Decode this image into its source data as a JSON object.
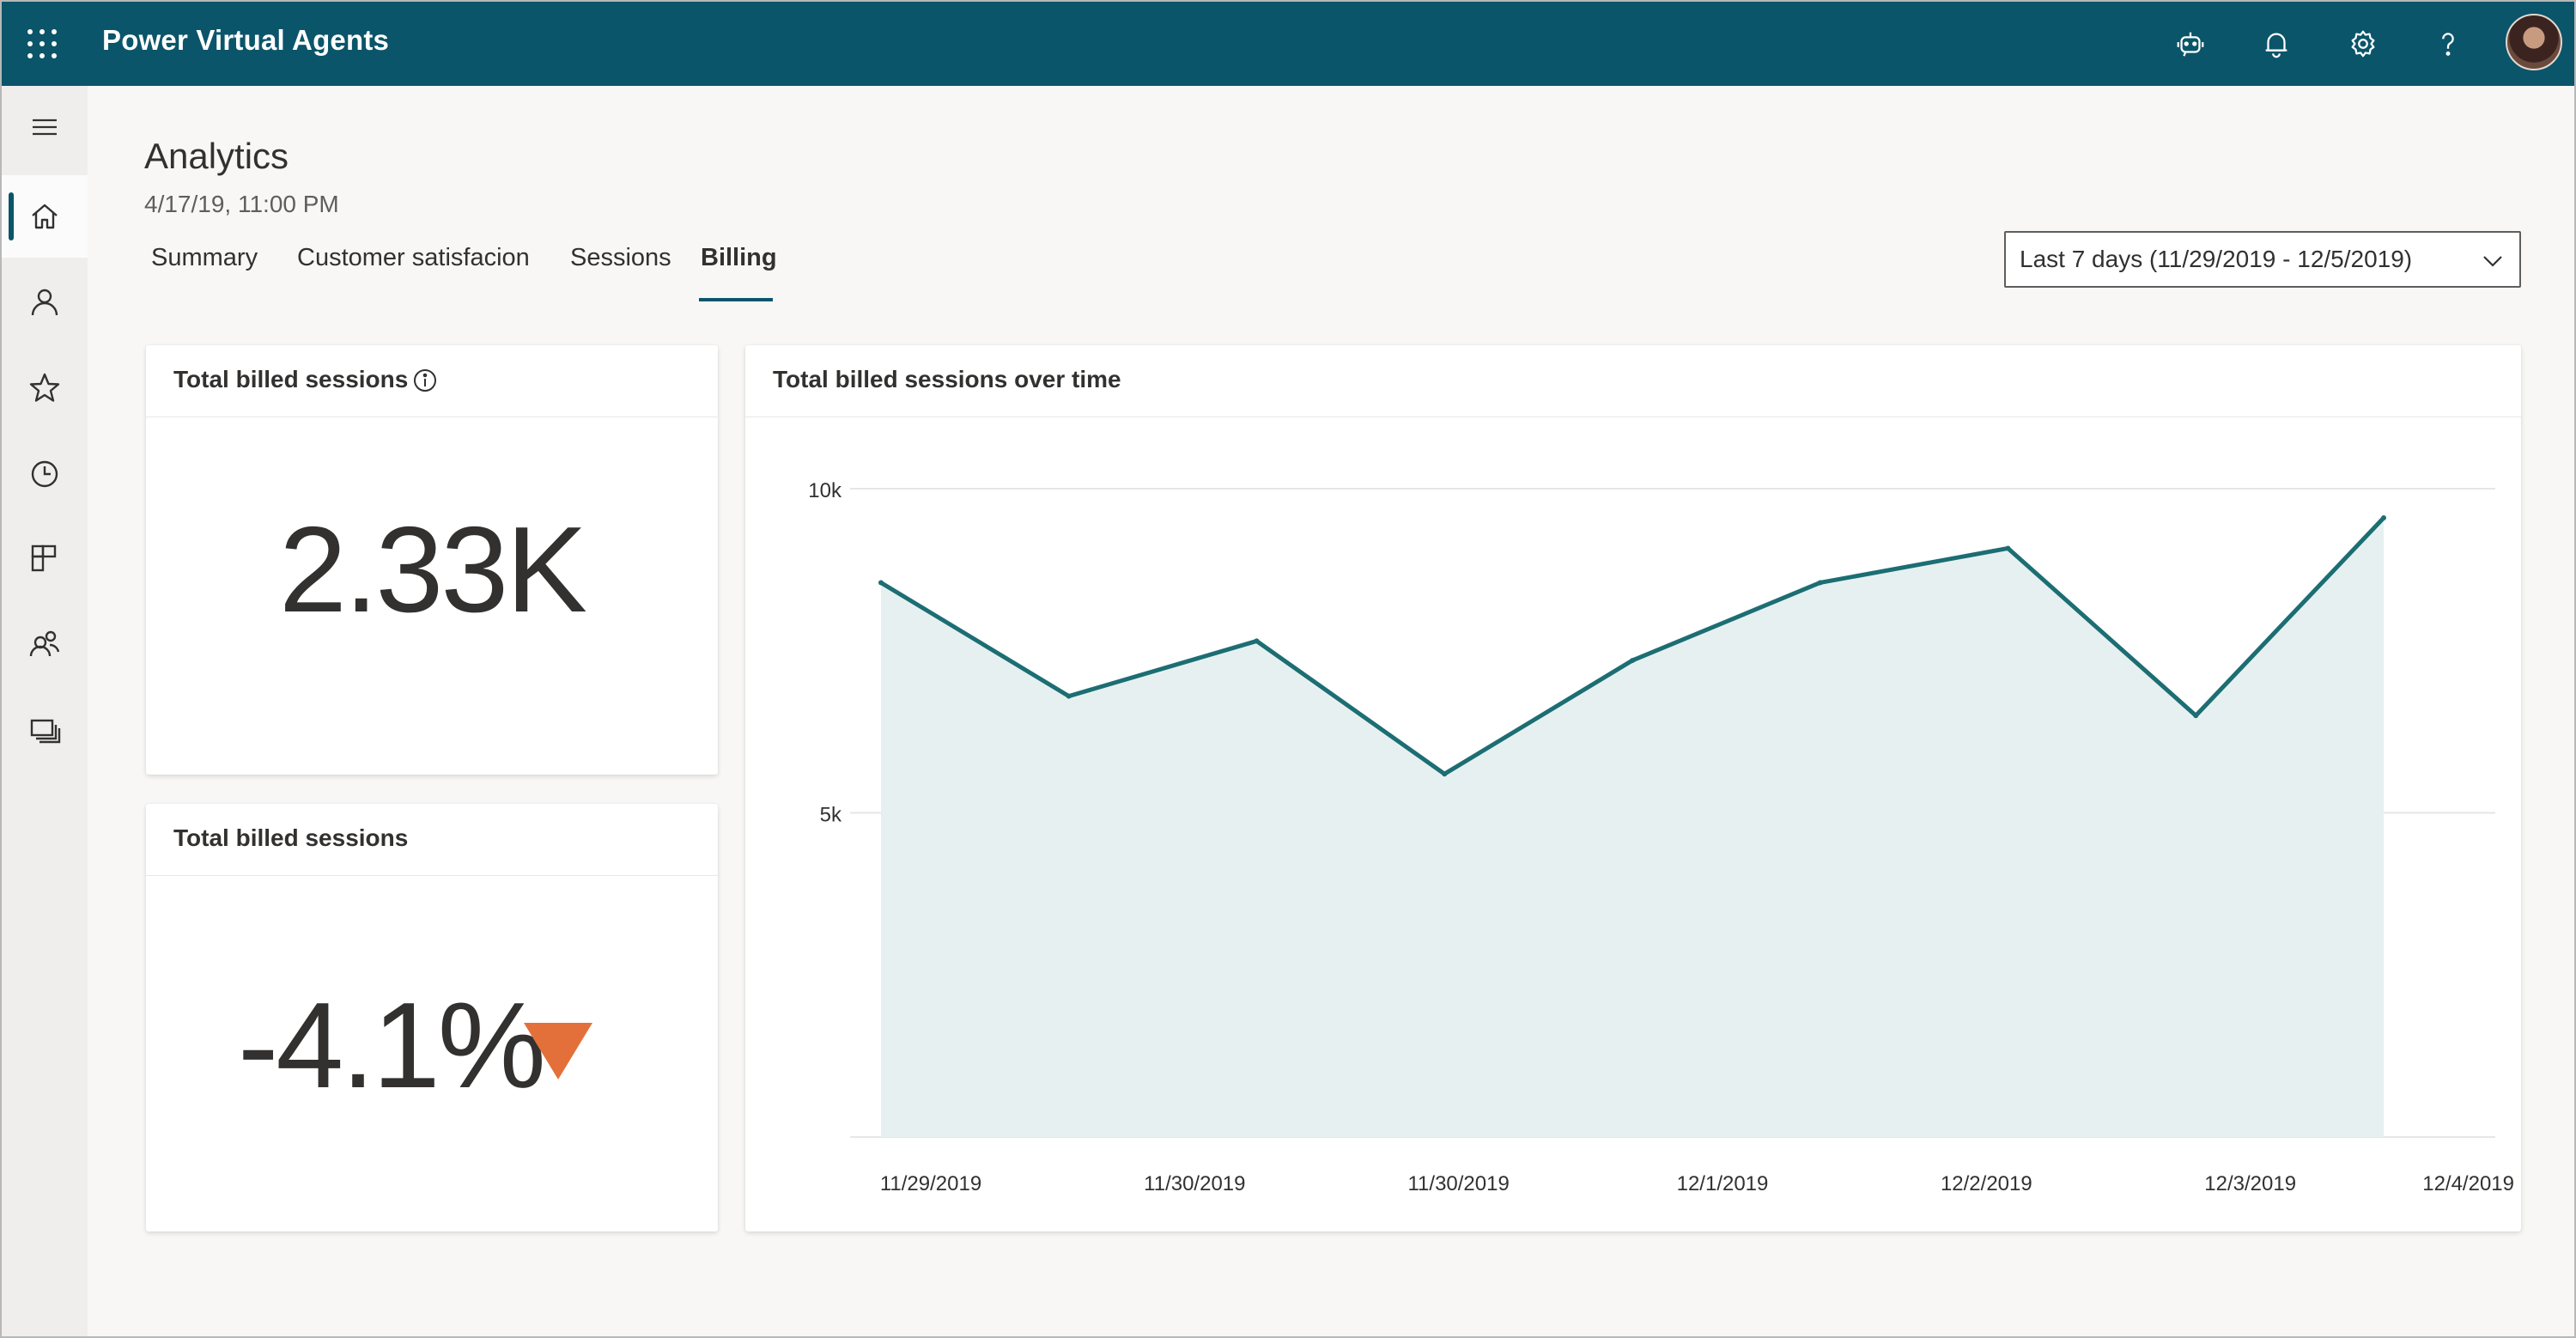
{
  "app": {
    "title": "Power Virtual Agents"
  },
  "header_icons": [
    "bot-icon",
    "bell-icon",
    "gear-icon",
    "help-icon"
  ],
  "rail": {
    "items": [
      {
        "name": "menu",
        "icon": "hamburger-icon"
      },
      {
        "name": "home",
        "icon": "home-icon",
        "active": true
      },
      {
        "name": "users",
        "icon": "person-icon"
      },
      {
        "name": "favorites",
        "icon": "star-icon"
      },
      {
        "name": "history",
        "icon": "clock-icon"
      },
      {
        "name": "components",
        "icon": "blocks-icon"
      },
      {
        "name": "people",
        "icon": "people-icon"
      },
      {
        "name": "publish",
        "icon": "stack-icon"
      }
    ]
  },
  "page": {
    "title": "Analytics",
    "timestamp": "4/17/19, 11:00 PM"
  },
  "tabs": [
    {
      "label": "Summary"
    },
    {
      "label": "Customer satisfacion"
    },
    {
      "label": "Sessions"
    },
    {
      "label": "Billing",
      "active": true
    }
  ],
  "date_range": {
    "selected": "Last 7 days (11/29/2019 - 12/5/2019)"
  },
  "cards": {
    "total": {
      "title": "Total billed sessions",
      "value": "2.33K"
    },
    "change": {
      "title": "Total billed sessions",
      "value": "-4.1%",
      "trend": "down",
      "trend_color": "#e3703a"
    },
    "over_time": {
      "title": "Total billed sessions over time"
    }
  },
  "colors": {
    "brand": "#0b556a",
    "line": "#1c6e73",
    "area": "#e7f0f0"
  },
  "chart_data": {
    "type": "area",
    "title": "Total billed sessions over time",
    "x_tick_labels": [
      "11/29/2019",
      "11/30/2019",
      "11/30/2019",
      "12/1/2019",
      "12/2/2019",
      "12/3/2019",
      "12/4/2019"
    ],
    "y_tick_labels": [
      "10k",
      "5k"
    ],
    "ylim": [
      0,
      10000
    ],
    "grid": true,
    "series": [
      {
        "values": [
          8550,
          6800,
          7650,
          5600,
          7350,
          8550,
          9080,
          6500,
          9550
        ]
      }
    ]
  }
}
